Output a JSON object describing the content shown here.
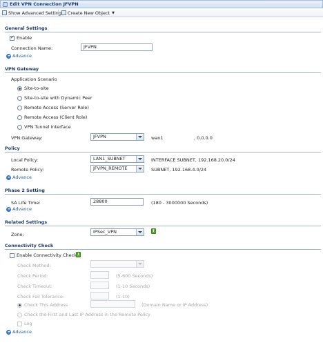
{
  "window": {
    "title": "Edit VPN Connection JFVPN"
  },
  "toolbar": {
    "show_advanced": "Show Advanced Settings",
    "create_new_object": "Create New Object"
  },
  "general": {
    "header": "General Settings",
    "enable_label": "Enable",
    "enable_checked": true,
    "connection_name_label": "Connection Name:",
    "connection_name_value": "JFVPN",
    "advance_label": "Advance"
  },
  "vpn_gateway": {
    "header": "VPN Gateway",
    "scenario_label": "Application Scenario",
    "options": [
      "Site-to-site",
      "Site-to-site with Dynamic Peer",
      "Remote Access (Server Role)",
      "Remote Access (Client Role)",
      "VPN Tunnel Interface"
    ],
    "selected_index": 0,
    "gateway_label": "VPN Gateway:",
    "gateway_value": "JFVPN",
    "gateway_info_prefix": "wan1",
    "gateway_info_suffix": ", 0.0.0.0"
  },
  "policy": {
    "header": "Policy",
    "local_label": "Local Policy:",
    "local_value": "LAN1_SUBNET",
    "local_info": "INTERFACE SUBNET, 192.168.20.0/24",
    "remote_label": "Remote Policy:",
    "remote_value": "JFVPN_REMOTE",
    "remote_info": "SUBNET, 192.168.4.0/24",
    "advance_label": "Advance"
  },
  "phase2": {
    "header": "Phase 2 Setting",
    "sa_label": "SA Life Time:",
    "sa_value": "28800",
    "sa_hint": "(180 - 3000000 Seconds)",
    "advance_label": "Advance"
  },
  "related": {
    "header": "Related Settings",
    "zone_label": "Zone:",
    "zone_value": "IPSec_VPN"
  },
  "connectivity": {
    "header": "Connectivity Check",
    "enable_label": "Enable Connectivity Check",
    "enable_checked": false,
    "method_label": "Check Method:",
    "period_label": "Check Period:",
    "period_hint": "(5-600 Seconds)",
    "timeout_label": "Check Timeout:",
    "timeout_hint": "(1-10 Seconds)",
    "fail_label": "Check Fail Tolerance:",
    "fail_hint": "(1-10)",
    "address_label": "Check This Address",
    "address_hint": "(Domain Name or IP Address)",
    "first_last_label": "Check the First and Last IP Address in the Remote Policy",
    "log_label": "Log",
    "advance_label": "Advance"
  },
  "colors": {
    "accent": "#1b365d",
    "link": "#2c5aa0",
    "zone_icon": "#5fae3a"
  }
}
